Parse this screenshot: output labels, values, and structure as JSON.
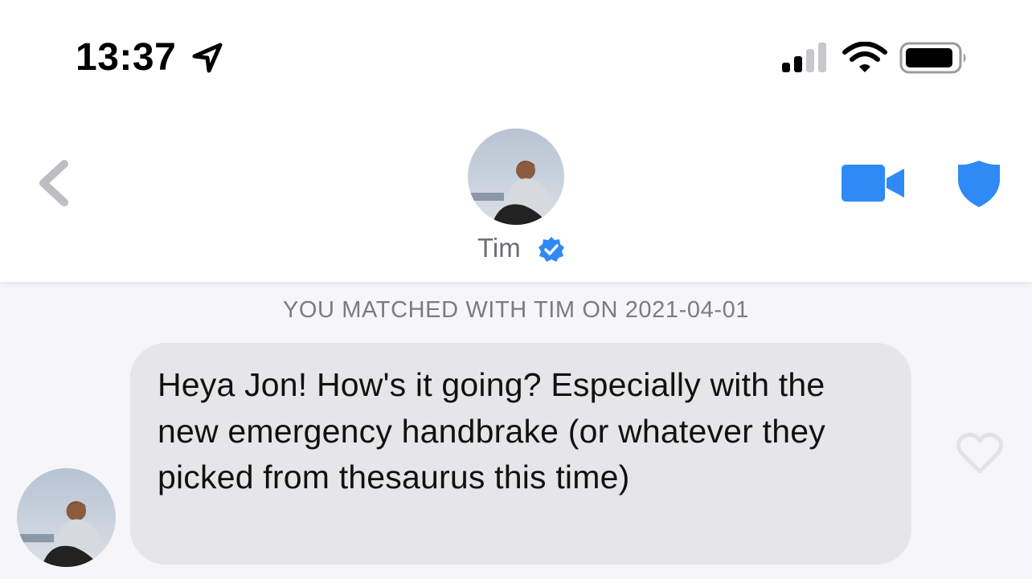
{
  "status_bar": {
    "time": "13:37",
    "location_icon": "location-arrow-icon",
    "signal_icon": "cellular-signal-icon",
    "wifi_icon": "wifi-icon",
    "battery_icon": "battery-icon"
  },
  "header": {
    "back_icon": "chevron-left-icon",
    "name": "Tim",
    "verified_icon": "verified-badge-icon",
    "video_icon": "video-camera-icon",
    "safety_icon": "shield-icon",
    "accent_color": "#2f8af5"
  },
  "chat": {
    "match_note": "YOU MATCHED WITH TIM ON 2021-04-01",
    "messages": [
      {
        "text": "Heya Jon! How's it going? Especially with the new emergency handbrake (or whatever they picked from thesaurus this time)",
        "like_icon": "heart-outline-icon"
      }
    ]
  }
}
